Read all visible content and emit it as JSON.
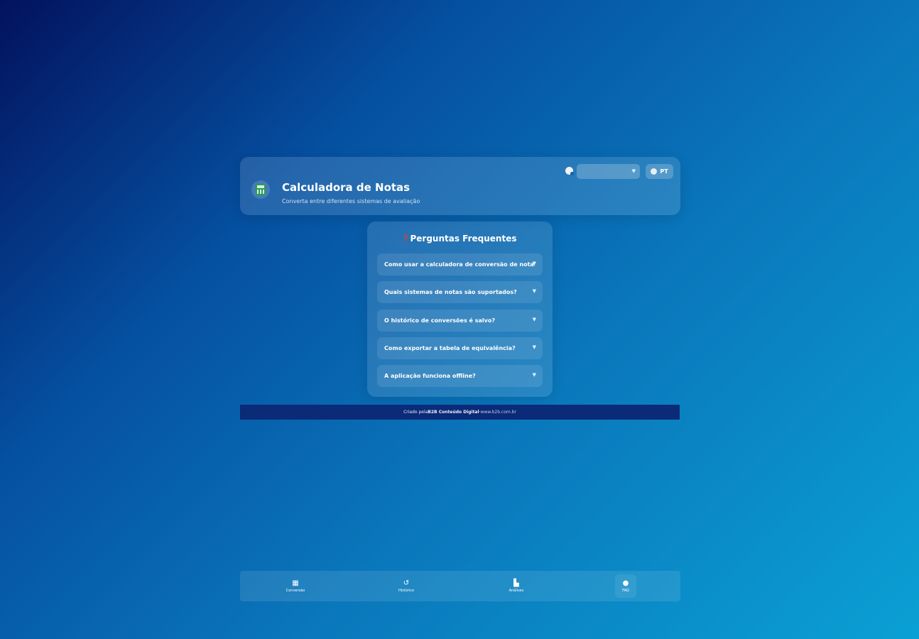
{
  "header": {
    "title": "Calculadora de Notas",
    "subtitle": "Converta entre diferentes sistemas de avaliação",
    "app_icon": "calculator-icon",
    "theme_select_value": "",
    "palette_icon": "palette-icon",
    "language_label": "PT",
    "language_icon": "globe-icon"
  },
  "faq": {
    "title": "Perguntas Frequentes",
    "title_icon": "question-mark-icon",
    "items": [
      {
        "question": "Como usar a calculadora de conversão de notas?"
      },
      {
        "question": "Quais sistemas de notas são suportados?"
      },
      {
        "question": "O histórico de conversões é salvo?"
      },
      {
        "question": "Como exportar a tabela de equivalência?"
      },
      {
        "question": "A aplicação funciona offline?"
      }
    ]
  },
  "footer": {
    "prefix": "Criado pela ",
    "brand": "B2B Conteúdo Digital",
    "separator": " · ",
    "site": "www.b2b.com.br"
  },
  "nav": {
    "items": [
      {
        "label": "Conversão",
        "icon": "calculator-icon"
      },
      {
        "label": "Histórico",
        "icon": "history-icon"
      },
      {
        "label": "Análises",
        "icon": "chart-icon"
      },
      {
        "label": "FAQ",
        "icon": "help-icon"
      }
    ],
    "active": "FAQ"
  },
  "colors": {
    "gradient_start": "#03125e",
    "gradient_end": "#0aa0d4",
    "footer_bar": "#0b2a78",
    "question_icon": "#e23a3a"
  }
}
